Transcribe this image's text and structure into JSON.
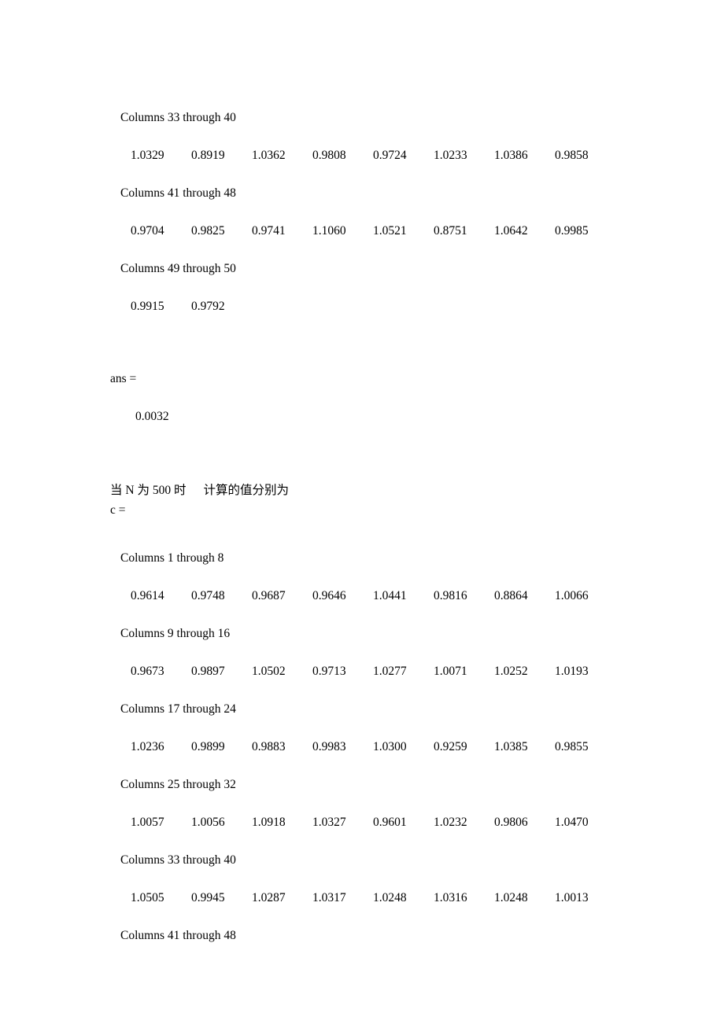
{
  "document": {
    "kind": "matlab-console-output",
    "page_background": "#ffffff",
    "text_color": "#000000"
  },
  "sections": [
    {
      "id": "section-n-first",
      "blocks": [
        {
          "type": "columns_label",
          "text": "Columns 33 through 40"
        },
        {
          "type": "values",
          "values": [
            "1.0329",
            "0.8919",
            "1.0362",
            "0.9808",
            "0.9724",
            "1.0233",
            "1.0386",
            "0.9858"
          ]
        },
        {
          "type": "columns_label",
          "text": "Columns 41 through 48"
        },
        {
          "type": "values",
          "values": [
            "0.9704",
            "0.9825",
            "0.9741",
            "1.1060",
            "1.0521",
            "0.8751",
            "1.0642",
            "0.9985"
          ]
        },
        {
          "type": "columns_label",
          "text": "Columns 49 through 50"
        },
        {
          "type": "values",
          "values": [
            "0.9915",
            "0.9792"
          ]
        }
      ]
    },
    {
      "id": "section-ans",
      "blocks": [
        {
          "type": "variable",
          "text": "ans ="
        },
        {
          "type": "scalar",
          "text": "0.0032"
        }
      ]
    },
    {
      "id": "section-n-500",
      "caption": {
        "prefix": "当 N 为 500 时",
        "suffix": "计算的值分别为"
      },
      "variable": "c =",
      "blocks": [
        {
          "type": "columns_label",
          "text": "Columns 1 through 8"
        },
        {
          "type": "values",
          "values": [
            "0.9614",
            "0.9748",
            "0.9687",
            "0.9646",
            "1.0441",
            "0.9816",
            "0.8864",
            "1.0066"
          ]
        },
        {
          "type": "columns_label",
          "text": "Columns 9 through 16"
        },
        {
          "type": "values",
          "values": [
            "0.9673",
            "0.9897",
            "1.0502",
            "0.9713",
            "1.0277",
            "1.0071",
            "1.0252",
            "1.0193"
          ]
        },
        {
          "type": "columns_label",
          "text": "Columns 17 through 24"
        },
        {
          "type": "values",
          "values": [
            "1.0236",
            "0.9899",
            "0.9883",
            "0.9983",
            "1.0300",
            "0.9259",
            "1.0385",
            "0.9855"
          ]
        },
        {
          "type": "columns_label",
          "text": "Columns 25 through 32"
        },
        {
          "type": "values",
          "values": [
            "1.0057",
            "1.0056",
            "1.0918",
            "1.0327",
            "0.9601",
            "1.0232",
            "0.9806",
            "1.0470"
          ]
        },
        {
          "type": "columns_label",
          "text": "Columns 33 through 40"
        },
        {
          "type": "values",
          "values": [
            "1.0505",
            "0.9945",
            "1.0287",
            "1.0317",
            "1.0248",
            "1.0316",
            "1.0248",
            "1.0013"
          ]
        },
        {
          "type": "columns_label",
          "text": "Columns 41 through 48"
        }
      ]
    }
  ]
}
